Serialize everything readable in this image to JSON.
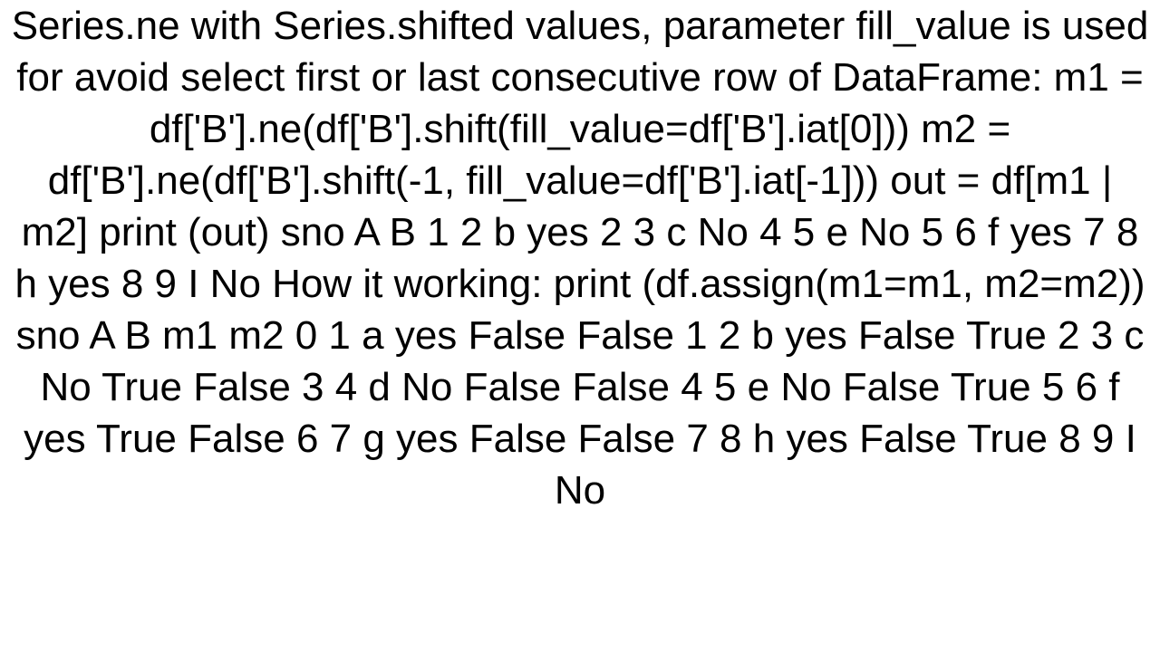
{
  "body": {
    "text": "Series.ne with Series.shifted values, parameter fill_value is used for avoid select first or last consecutive row of DataFrame: m1 = df['B'].ne(df['B'].shift(fill_value=df['B'].iat[0])) m2 = df['B'].ne(df['B'].shift(-1, fill_value=df['B'].iat[-1])) out = df[m1 | m2] print (out)    sno  A    B 1     2  b  yes 2     3  c   No 4     5  e   No 5     6  f  yes 7     8  h  yes 8     9  I   No  How it working: print (df.assign(m1=m1, m2=m2))    sno  A    B     m1     m2 0    1  a  yes  False  False 1    2  b  yes  False   True 2    3  c   No   True  False 3    4  d   No  False  False 4    5  e   No  False   True 5    6  f  yes   True  False 6    7  g  yes  False  False 7    8  h  yes  False   True 8    9  I   No"
  }
}
